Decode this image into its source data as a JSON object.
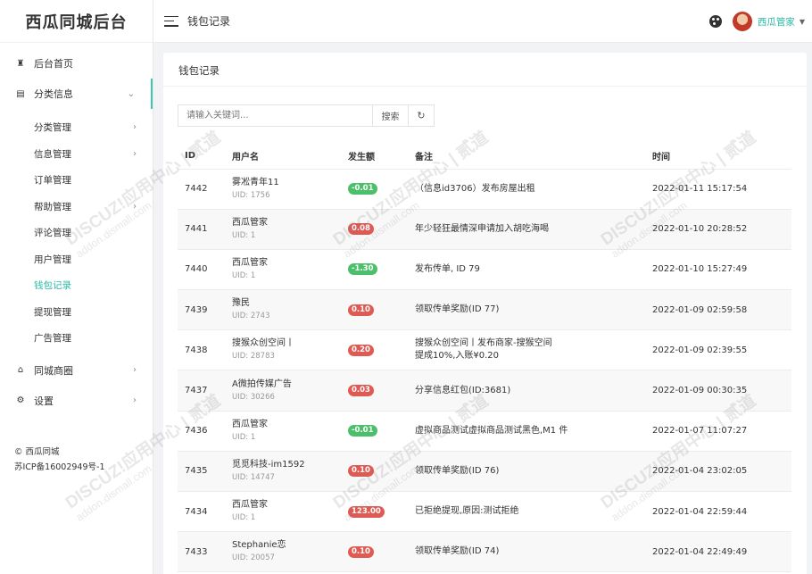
{
  "app": {
    "logo": "西瓜同城后台"
  },
  "header": {
    "title": "钱包记录",
    "user_name": "西瓜管家"
  },
  "sidebar": {
    "items": [
      {
        "label": "后台首页",
        "icon": "home-icon"
      },
      {
        "label": "分类信息",
        "icon": "list-icon"
      }
    ],
    "sub_items": [
      {
        "label": "分类管理",
        "has_children": true
      },
      {
        "label": "信息管理",
        "has_children": true
      },
      {
        "label": "订单管理",
        "has_children": false
      },
      {
        "label": "帮助管理",
        "has_children": true
      },
      {
        "label": "评论管理",
        "has_children": false
      },
      {
        "label": "用户管理",
        "has_children": false
      },
      {
        "label": "钱包记录",
        "has_children": false,
        "active": true
      },
      {
        "label": "提现管理",
        "has_children": false
      },
      {
        "label": "广告管理",
        "has_children": false
      }
    ],
    "bottom_items": [
      {
        "label": "同城商圈",
        "icon": "shop-icon"
      },
      {
        "label": "设置",
        "icon": "gear-icon"
      }
    ],
    "copyright": "© 西瓜同城",
    "icp": "苏ICP备16002949号-1"
  },
  "card": {
    "title": "钱包记录",
    "search": {
      "placeholder": "请输入关键词...",
      "button": "搜索"
    },
    "columns": [
      "ID",
      "用户名",
      "发生额",
      "备注",
      "时间"
    ],
    "rows": [
      {
        "id": "7442",
        "user": "雾凇青年11",
        "uid": "UID: 1756",
        "amount": "-0.01",
        "type": "neg",
        "note": "（信息id3706）发布房屋出租",
        "time": "2022-01-11 15:17:54"
      },
      {
        "id": "7441",
        "user": "西瓜管家",
        "uid": "UID: 1",
        "amount": "0.08",
        "type": "pos",
        "note": "年少轻狂最情深申请加入胡吃海喝",
        "time": "2022-01-10 20:28:52"
      },
      {
        "id": "7440",
        "user": "西瓜管家",
        "uid": "UID: 1",
        "amount": "-1.30",
        "type": "neg",
        "note": "发布传单, ID 79",
        "time": "2022-01-10 15:27:49"
      },
      {
        "id": "7439",
        "user": "豫民",
        "uid": "UID: 2743",
        "amount": "0.10",
        "type": "pos",
        "note": "领取传单奖励(ID 77)",
        "time": "2022-01-09 02:59:58"
      },
      {
        "id": "7438",
        "user": "搜猴众创空间丨",
        "uid": "UID: 28783",
        "amount": "0.20",
        "type": "pos",
        "note": "搜猴众创空间丨发布商家-搜猴空间\n提成10%,入账¥0.20",
        "time": "2022-01-09 02:39:55"
      },
      {
        "id": "7437",
        "user": "A微拍传媒广告",
        "uid": "UID: 30266",
        "amount": "0.03",
        "type": "pos",
        "note": "分享信息红包(ID:3681)",
        "time": "2022-01-09 00:30:35"
      },
      {
        "id": "7436",
        "user": "西瓜管家",
        "uid": "UID: 1",
        "amount": "-0.01",
        "type": "neg",
        "note": "虚拟商品测试虚拟商品测试黑色,M1 件",
        "time": "2022-01-07 11:07:27"
      },
      {
        "id": "7435",
        "user": "觅觅科技-im1592",
        "uid": "UID: 14747",
        "amount": "0.10",
        "type": "pos",
        "note": "领取传单奖励(ID 76)",
        "time": "2022-01-04 23:02:05"
      },
      {
        "id": "7434",
        "user": "西瓜管家",
        "uid": "UID: 1",
        "amount": "123.00",
        "type": "pos",
        "note": "已拒绝提现,原因:测试拒绝",
        "time": "2022-01-04 22:59:44"
      },
      {
        "id": "7433",
        "user": "Stephanie恋",
        "uid": "UID: 20057",
        "amount": "0.10",
        "type": "pos",
        "note": "领取传单奖励(ID 74)",
        "time": "2022-01-04 22:49:49"
      }
    ]
  },
  "watermark": {
    "line1": "DISCUZ!应用中心 | 贰道",
    "line2": "addon.dismall.com"
  }
}
